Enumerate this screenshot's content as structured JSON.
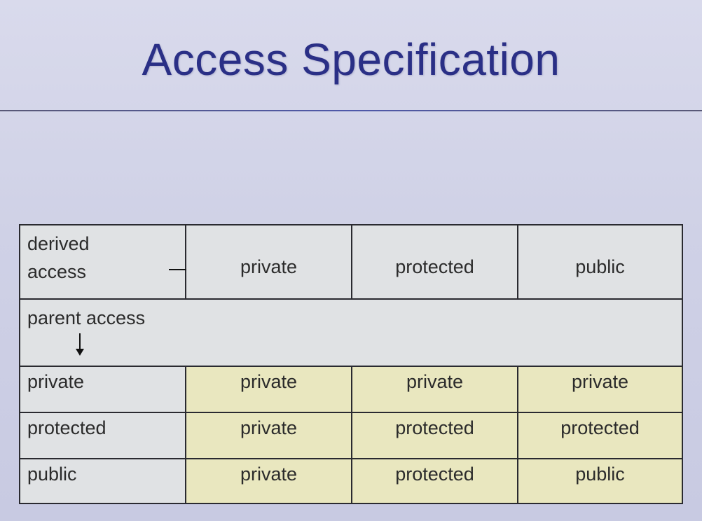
{
  "title": "Access Specification",
  "header": {
    "corner_line1": "derived",
    "corner_line2": "access",
    "columns": [
      "private",
      "protected",
      "public"
    ]
  },
  "parent_row": {
    "label": "parent access"
  },
  "rows": [
    {
      "label": "private",
      "cells": [
        "private",
        "private",
        "private"
      ]
    },
    {
      "label": "protected",
      "cells": [
        "private",
        "protected",
        "protected"
      ]
    },
    {
      "label": "public",
      "cells": [
        "private",
        "protected",
        "public"
      ]
    }
  ],
  "colors": {
    "title": "#2a2f86",
    "grey_cell": "#e0e2e4",
    "yellow_cell": "#e9e7bf",
    "grid": "#2a2a30"
  }
}
